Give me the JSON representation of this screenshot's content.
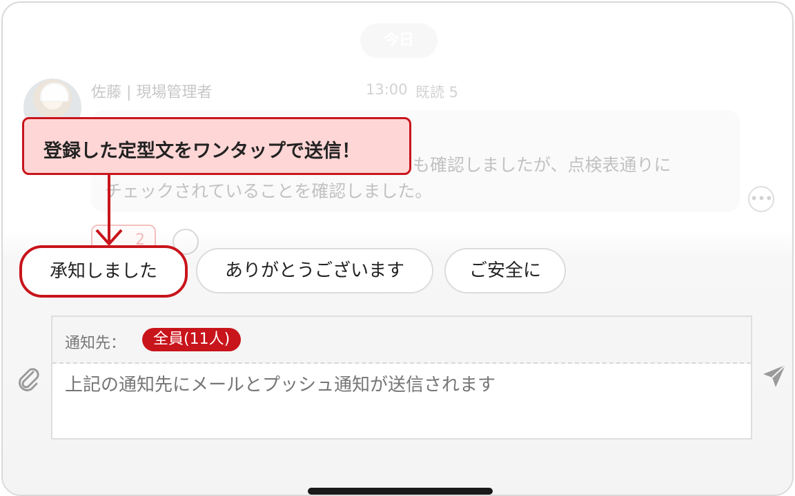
{
  "date_divider": "今日",
  "message": {
    "sender": "佐藤 | 現場管理者",
    "time": "13:00",
    "read_status": "既読 5",
    "body_line1": "も確認しましたが、点検表通りに",
    "body_line2": "チェックされていることを確認しました。",
    "reaction_count": "2",
    "more_icon": "ellipsis-icon"
  },
  "callout": {
    "text": "登録した定型文をワンタップで送信！"
  },
  "quick_replies": [
    {
      "label": "承知しました"
    },
    {
      "label": "ありがとうございます"
    },
    {
      "label": "ご安全に"
    }
  ],
  "composer": {
    "notify_label": "通知先：",
    "notify_badge": "全員(11人)",
    "placeholder": "上記の通知先にメールとプッシュ通知が送信されます",
    "attach_icon": "paperclip-icon",
    "send_icon": "send-icon"
  },
  "colors": {
    "accent": "#c8141b",
    "callout_bg": "#ffd6d6"
  }
}
